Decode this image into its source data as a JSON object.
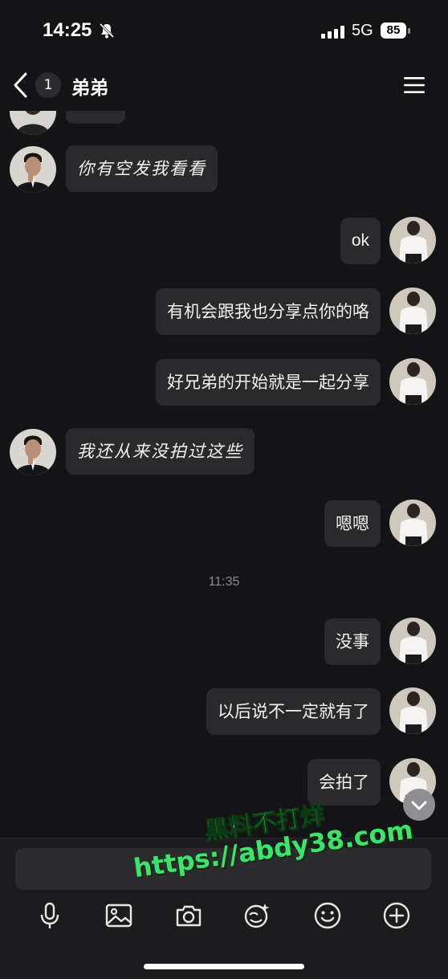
{
  "status_bar": {
    "time": "14:25",
    "network": "5G",
    "battery": "85"
  },
  "nav": {
    "unread_count": "1",
    "title": "弟弟"
  },
  "messages": [
    {
      "side": "left",
      "text": "你有空发我看看"
    },
    {
      "side": "right",
      "text": "ok"
    },
    {
      "side": "right",
      "text": "有机会跟我也分享点你的咯"
    },
    {
      "side": "right",
      "text": "好兄弟的开始就是一起分享"
    },
    {
      "side": "left",
      "text": "我还从来没拍过这些"
    },
    {
      "side": "right",
      "text": "嗯嗯"
    },
    {
      "side": "right",
      "text": "没事"
    },
    {
      "side": "right",
      "text": "以后说不一定就有了"
    },
    {
      "side": "right",
      "text": "会拍了"
    }
  ],
  "timestamp": "11:35",
  "toolbar": [
    "microphone-icon",
    "image-icon",
    "camera-icon",
    "sticker-icon",
    "emoji-icon",
    "plus-icon"
  ],
  "watermark": {
    "line1": "黑料不打烊",
    "line2": "https://abdy38.com"
  },
  "colors": {
    "background": "#141416",
    "bubble": "#2a2a2c",
    "watermark": "#3ee36b"
  }
}
